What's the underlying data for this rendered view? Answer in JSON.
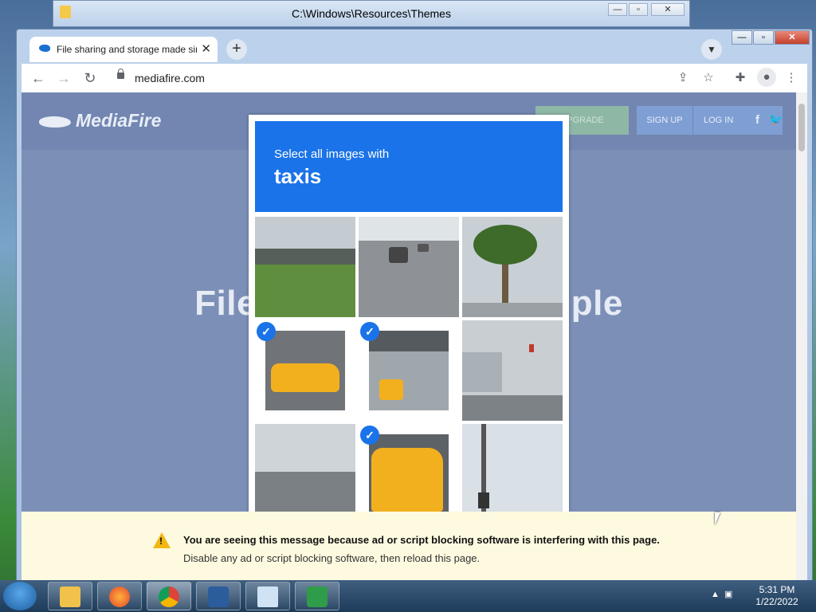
{
  "explorer": {
    "title": "C:\\Windows\\Resources\\Themes"
  },
  "browser": {
    "tab_title": "File sharing and storage made simple",
    "tab_close": "✕",
    "new_tab": "+",
    "url": "mediafire.com"
  },
  "page": {
    "logo": "MediaFire",
    "upgrade": "UPGRADE",
    "signup": "SIGN UP",
    "login": "LOG IN",
    "hero": "File storage made simple"
  },
  "captcha": {
    "instruction": "Select all images with",
    "target": "taxis",
    "tiles": [
      {
        "label": "park road",
        "selected": false
      },
      {
        "label": "highway cars",
        "selected": false
      },
      {
        "label": "palm tree",
        "selected": false
      },
      {
        "label": "yellow taxi",
        "selected": true
      },
      {
        "label": "taxi under overpass",
        "selected": true
      },
      {
        "label": "traffic lights",
        "selected": false
      },
      {
        "label": "highway",
        "selected": false
      },
      {
        "label": "yellow taxi close",
        "selected": true
      },
      {
        "label": "traffic light sky",
        "selected": false
      }
    ]
  },
  "notice": {
    "line1": "You are seeing this message because ad or script blocking software is interfering with this page.",
    "line2": "Disable any ad or script blocking software, then reload this page."
  },
  "taskbar": {
    "time": "5:31 PM",
    "date": "1/22/2022"
  },
  "colors": {
    "captcha_blue": "#1a73e8",
    "notice_bg": "#fdfae0",
    "page_dim": "#7c8fb6"
  }
}
